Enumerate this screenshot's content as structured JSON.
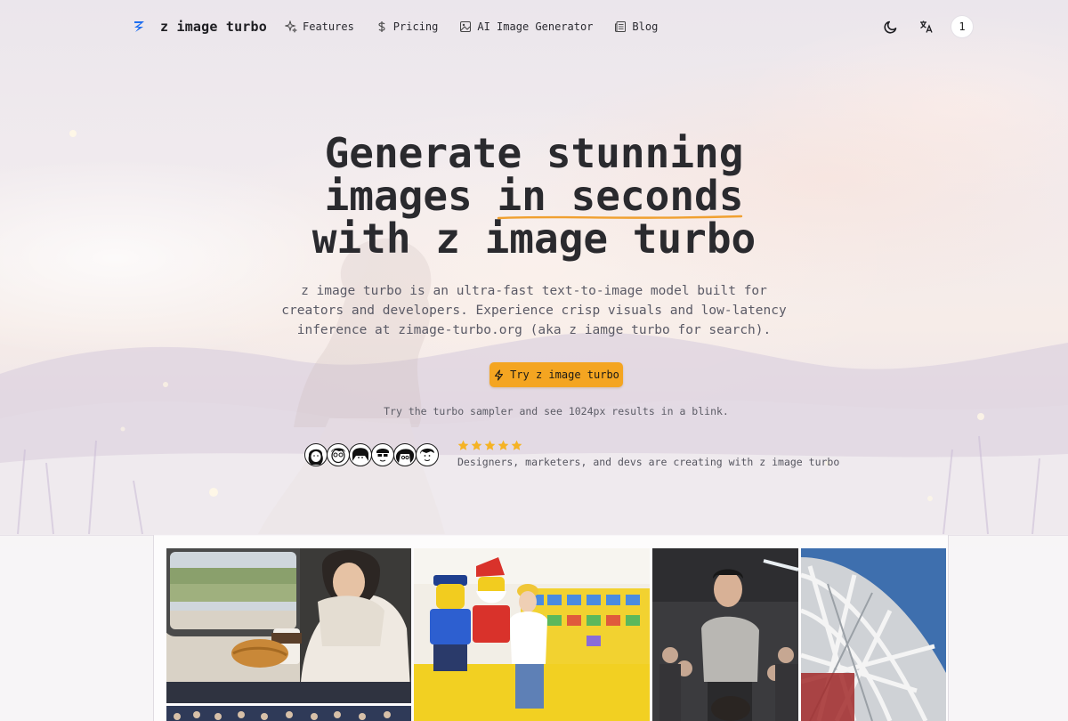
{
  "brand": {
    "name": "z image turbo",
    "logo_icon": "z-bolt-logo-icon",
    "accent_color": "#1e6ef0"
  },
  "nav": {
    "items": [
      {
        "label": "Features",
        "icon": "sparkles-icon"
      },
      {
        "label": "Pricing",
        "icon": "dollar-icon"
      },
      {
        "label": "AI Image Generator",
        "icon": "image-icon"
      },
      {
        "label": "Blog",
        "icon": "newspaper-icon"
      }
    ]
  },
  "header_actions": {
    "theme_toggle_icon": "moon-icon",
    "language_icon": "translate-icon",
    "user_badge": "1"
  },
  "hero": {
    "title_line1": "Generate stunning",
    "title_line2_pre": "images ",
    "title_line2_highlight": "in seconds",
    "title_line3": "with z image turbo",
    "highlight_color": "#f0a030",
    "subtitle": "z image turbo is an ultra-fast text-to-image model built for creators and developers. Experience crisp visuals and low-latency inference at zimage-turbo.org (aka z iamge turbo for search).",
    "cta_label": "Try z image turbo",
    "cta_icon": "zap-icon",
    "cta_color": "#f4a521",
    "cta_note": "Try the turbo sampler and see 1024px results in a blink."
  },
  "social_proof": {
    "rating_stars": 5,
    "star_color": "#f5b324",
    "text": "Designers, marketers, and devs are creating with z image turbo",
    "avatar_count": 6
  },
  "gallery": {
    "tiles": [
      {
        "name": "train-window-croissant-tile"
      },
      {
        "name": "lego-santa-toy-store-tile"
      },
      {
        "name": "man-with-dog-event-tile"
      },
      {
        "name": "stadium-steel-lattice-tile"
      },
      {
        "name": "crowd-stadium-tile"
      }
    ]
  }
}
